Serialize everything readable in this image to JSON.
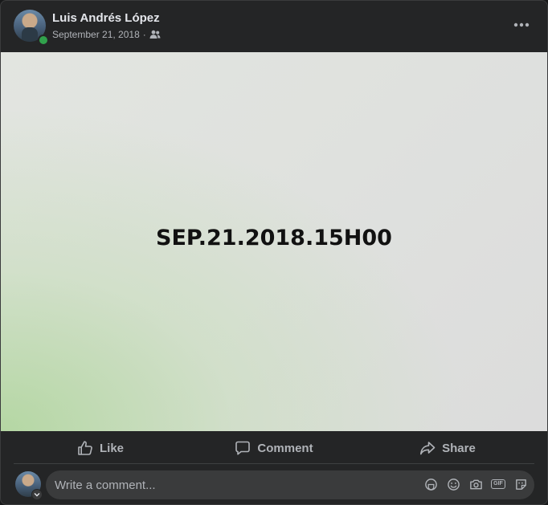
{
  "post": {
    "author": "Luis Andrés López",
    "date": "September 21, 2018",
    "separator": "·",
    "audience_icon": "friends-icon",
    "more_icon": "more-horizontal-icon",
    "image_text": "SEP.21.2018.15H00"
  },
  "actions": {
    "like": "Like",
    "comment": "Comment",
    "share": "Share"
  },
  "comment_box": {
    "placeholder": "Write a comment...",
    "icons": [
      "avatar-sticker-icon",
      "emoji-icon",
      "camera-icon",
      "gif-icon",
      "sticker-icon"
    ],
    "gif_label": "GIF"
  },
  "colors": {
    "background": "#242526",
    "text_primary": "#e4e6eb",
    "text_secondary": "#b0b3b8",
    "online": "#31a24c",
    "input_bg": "#3a3b3c"
  }
}
